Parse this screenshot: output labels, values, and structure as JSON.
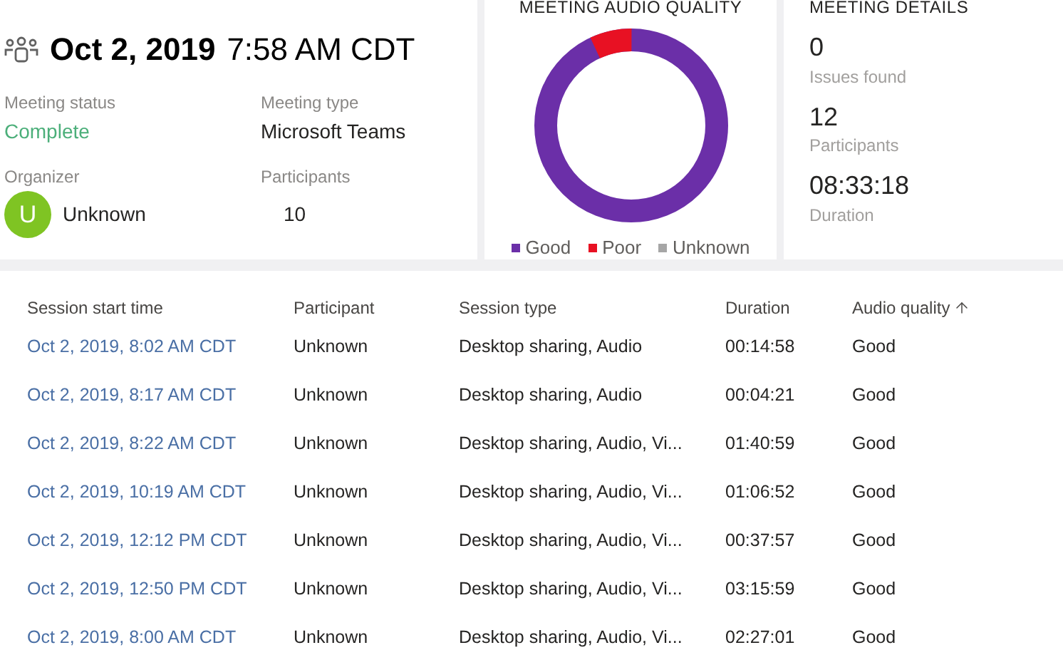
{
  "meeting": {
    "date": "Oct 2, 2019",
    "time": "7:58 AM CDT",
    "fields": [
      {
        "label": "Meeting status",
        "value": "Complete",
        "kind": "status"
      },
      {
        "label": "Meeting type",
        "value": "Microsoft Teams",
        "kind": "text"
      },
      {
        "label": "Organizer",
        "value": "Unknown",
        "initial": "U",
        "kind": "person"
      },
      {
        "label": "Participants",
        "value": "10",
        "kind": "count"
      }
    ]
  },
  "audio_quality": {
    "title": "MEETING AUDIO QUALITY",
    "legend": [
      {
        "label": "Good",
        "color": "#6b2fa8"
      },
      {
        "label": "Poor",
        "color": "#e81123"
      },
      {
        "label": "Unknown",
        "color": "#a6a6a6"
      }
    ]
  },
  "details": {
    "title": "MEETING DETAILS",
    "stats": [
      {
        "value": "0",
        "label": "Issues found"
      },
      {
        "value": "12",
        "label": "Participants"
      },
      {
        "value": "08:33:18",
        "label": "Duration"
      }
    ]
  },
  "table": {
    "columns": [
      {
        "label": "Session start time",
        "sorted": false
      },
      {
        "label": "Participant",
        "sorted": false
      },
      {
        "label": "Session type",
        "sorted": false
      },
      {
        "label": "Duration",
        "sorted": false
      },
      {
        "label": "Audio quality",
        "sorted": true
      }
    ],
    "rows": [
      [
        "Oct 2, 2019, 8:02 AM CDT",
        "Unknown",
        "Desktop sharing, Audio",
        "00:14:58",
        "Good"
      ],
      [
        "Oct 2, 2019, 8:17 AM CDT",
        "Unknown",
        "Desktop sharing, Audio",
        "00:04:21",
        "Good"
      ],
      [
        "Oct 2, 2019, 8:22 AM CDT",
        "Unknown",
        "Desktop sharing, Audio, Vi...",
        "01:40:59",
        "Good"
      ],
      [
        "Oct 2, 2019, 10:19 AM CDT",
        "Unknown",
        "Desktop sharing, Audio, Vi...",
        "01:06:52",
        "Good"
      ],
      [
        "Oct 2, 2019, 12:12 PM CDT",
        "Unknown",
        "Desktop sharing, Audio, Vi...",
        "00:37:57",
        "Good"
      ],
      [
        "Oct 2, 2019, 12:50 PM CDT",
        "Unknown",
        "Desktop sharing, Audio, Vi...",
        "03:15:59",
        "Good"
      ],
      [
        "Oct 2, 2019, 8:00 AM CDT",
        "Unknown",
        "Desktop sharing, Audio, Vi...",
        "02:27:01",
        "Good"
      ]
    ]
  }
}
